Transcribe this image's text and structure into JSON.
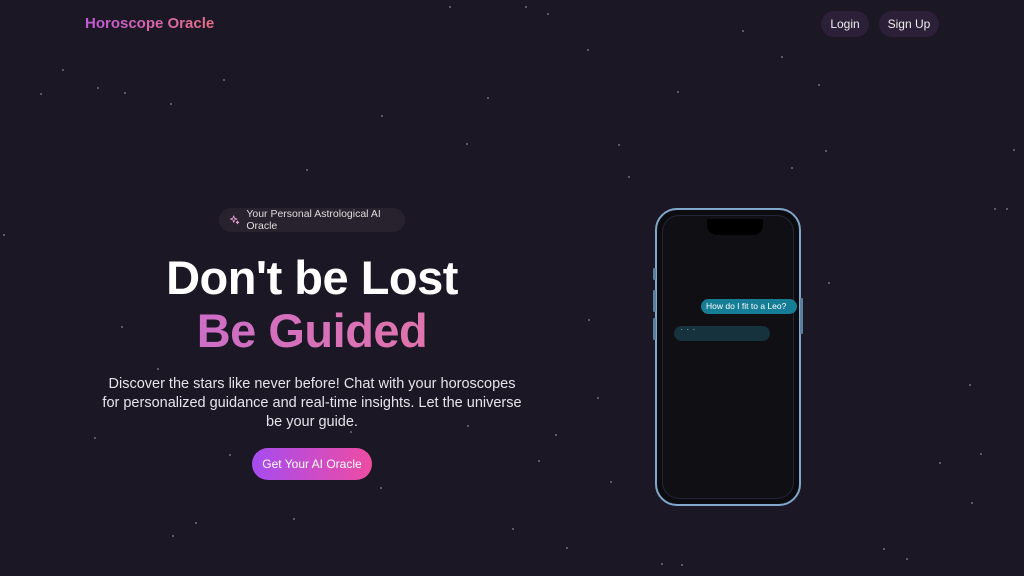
{
  "header": {
    "brand": "Horoscope Oracle",
    "login_label": "Login",
    "signup_label": "Sign Up"
  },
  "hero": {
    "badge_icon": "sparkles-icon",
    "badge_text": "Your Personal Astrological AI Oracle",
    "title_line1": "Don't be Lost",
    "title_line2": "Be Guided",
    "description": "Discover the stars like never before! Chat with your horoscopes for personalized guidance and real-time insights. Let the universe be your guide.",
    "cta_label": "Get Your AI Oracle"
  },
  "phone": {
    "user_message": "How do I fit to a Leo?",
    "typing_indicator": "· · ·"
  },
  "colors": {
    "background": "#1b1724",
    "accent_start": "#a64cf0",
    "accent_end": "#ee4ca2",
    "chat_bubble": "#157e96"
  }
}
